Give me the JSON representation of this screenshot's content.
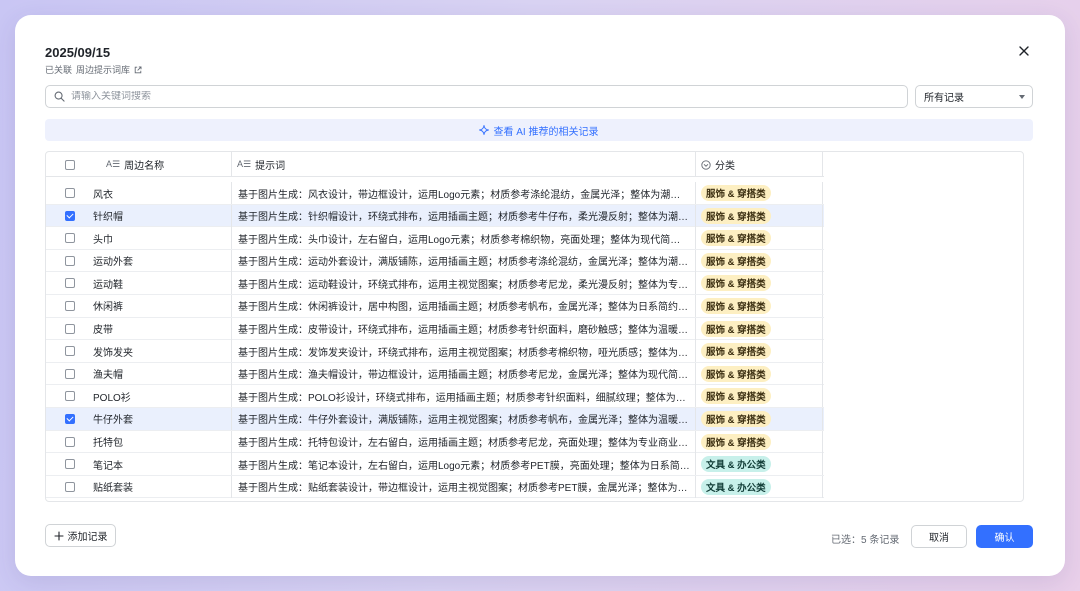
{
  "dialog": {
    "title": "2025/09/15",
    "linked_label": "已关联",
    "linked_target": "周边提示词库"
  },
  "search": {
    "placeholder": "请输入关键词搜索",
    "value": ""
  },
  "filter": {
    "selected": "所有记录"
  },
  "ai_bar": {
    "label": "查看 AI 推荐的相关记录"
  },
  "table": {
    "columns": {
      "name": "周边名称",
      "prompt": "提示词",
      "category": "分类"
    },
    "rows": [
      {
        "checked": false,
        "name": "风衣",
        "prompt": "基于图片生成：风衣设计，带边框设计，运用Logo元素；材质参考涤纶混纺，金属光泽；整体为潮流风格",
        "category": "服饰 & 穿搭类",
        "cat_type": "apparel"
      },
      {
        "checked": true,
        "name": "针织帽",
        "prompt": "基于图片生成：针织帽设计，环绕式排布，运用插画主题；材质参考牛仔布，柔光漫反射；整体为潮流风格",
        "category": "服饰 & 穿搭类",
        "cat_type": "apparel"
      },
      {
        "checked": false,
        "name": "头巾",
        "prompt": "基于图片生成：头巾设计，左右留白，运用Logo元素；材质参考棉织物，亮面处理；整体为现代简洁风格",
        "category": "服饰 & 穿搭类",
        "cat_type": "apparel"
      },
      {
        "checked": false,
        "name": "运动外套",
        "prompt": "基于图片生成：运动外套设计，满版铺陈，运用插画主题；材质参考涤纶混纺，金属光泽；整体为潮流风格",
        "category": "服饰 & 穿搭类",
        "cat_type": "apparel"
      },
      {
        "checked": false,
        "name": "运动鞋",
        "prompt": "基于图片生成：运动鞋设计，环绕式排布，运用主视觉图案；材质参考尼龙，柔光漫反射；整体为专业风格",
        "category": "服饰 & 穿搭类",
        "cat_type": "apparel"
      },
      {
        "checked": false,
        "name": "休闲裤",
        "prompt": "基于图片生成：休闲裤设计，居中构图，运用插画主题；材质参考帆布，金属光泽；整体为日系简约风格",
        "category": "服饰 & 穿搭类",
        "cat_type": "apparel"
      },
      {
        "checked": false,
        "name": "皮带",
        "prompt": "基于图片生成：皮带设计，环绕式排布，运用插画主题；材质参考针织面料，磨砂触感；整体为温暖风格",
        "category": "服饰 & 穿搭类",
        "cat_type": "apparel"
      },
      {
        "checked": false,
        "name": "发饰发夹",
        "prompt": "基于图片生成：发饰发夹设计，环绕式排布，运用主视觉图案；材质参考棉织物，哑光质感；整体为潮流风格",
        "category": "服饰 & 穿搭类",
        "cat_type": "apparel"
      },
      {
        "checked": false,
        "name": "渔夫帽",
        "prompt": "基于图片生成：渔夫帽设计，带边框设计，运用插画主题；材质参考尼龙，金属光泽；整体为现代简洁风格",
        "category": "服饰 & 穿搭类",
        "cat_type": "apparel"
      },
      {
        "checked": false,
        "name": "POLO衫",
        "prompt": "基于图片生成：POLO衫设计，环绕式排布，运用插画主题；材质参考针织面料，细腻纹理；整体为日系风格",
        "category": "服饰 & 穿搭类",
        "cat_type": "apparel"
      },
      {
        "checked": true,
        "name": "牛仔外套",
        "prompt": "基于图片生成：牛仔外套设计，满版铺陈，运用主视觉图案；材质参考帆布，金属光泽；整体为温暖风格",
        "category": "服饰 & 穿搭类",
        "cat_type": "apparel"
      },
      {
        "checked": false,
        "name": "托特包",
        "prompt": "基于图片生成：托特包设计，左右留白，运用插画主题；材质参考尼龙，亮面处理；整体为专业商业风格",
        "category": "服饰 & 穿搭类",
        "cat_type": "apparel"
      },
      {
        "checked": false,
        "name": "笔记本",
        "prompt": "基于图片生成：笔记本设计，左右留白，运用Logo元素；材质参考PET膜，亮面处理；整体为日系简约风格",
        "category": "文具 & 办公类",
        "cat_type": "stationery"
      },
      {
        "checked": false,
        "name": "贴纸套装",
        "prompt": "基于图片生成：贴纸套装设计，带边框设计，运用主视觉图案；材质参考PET膜，金属光泽；整体为潮流风格",
        "category": "文具 & 办公类",
        "cat_type": "stationery"
      }
    ]
  },
  "footer": {
    "add_label": "添加记录",
    "selected_text": "已选：5 条记录",
    "cancel_label": "取消",
    "confirm_label": "确认"
  },
  "colors": {
    "accent": "#3370ff",
    "apparel_tag_bg": "#fdefc2",
    "stationery_tag_bg": "#c7f0ea",
    "selected_row_bg": "#eaf0fd"
  }
}
